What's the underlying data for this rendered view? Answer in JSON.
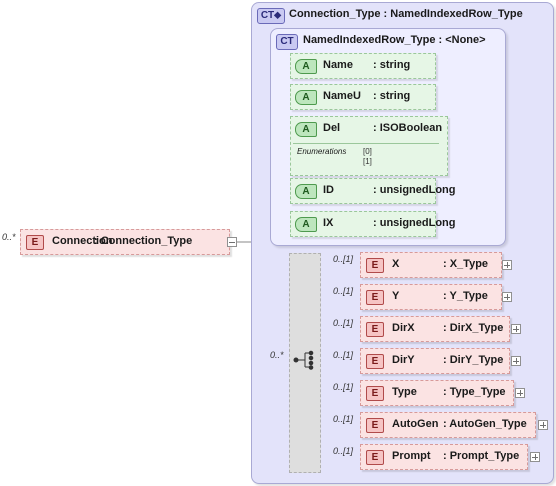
{
  "root_element": {
    "badge": "E",
    "name": "Connection",
    "type": ": Connection_Type",
    "cardinality": "0..*"
  },
  "outer_complex_type": {
    "badge": "CT",
    "title": "Connection_Type : NamedIndexedRow_Type"
  },
  "inner_complex_type": {
    "badge": "CT",
    "title": "NamedIndexedRow_Type : <None>"
  },
  "attributes": [
    {
      "badge": "A",
      "name": "Name",
      "type": ": string"
    },
    {
      "badge": "A",
      "name": "NameU",
      "type": ": string"
    },
    {
      "badge": "A",
      "name": "Del",
      "type": ": ISOBoolean",
      "enum_label": "Enumerations",
      "enum_values": [
        "[0]",
        "[1]"
      ]
    },
    {
      "badge": "A",
      "name": "ID",
      "type": ": unsignedLong"
    },
    {
      "badge": "A",
      "name": "IX",
      "type": ": unsignedLong"
    }
  ],
  "sequence_cardinality": "0..*",
  "child_elements": [
    {
      "badge": "E",
      "name": "X",
      "type": ": X_Type",
      "cardinality": "0..[1]"
    },
    {
      "badge": "E",
      "name": "Y",
      "type": ": Y_Type",
      "cardinality": "0..[1]"
    },
    {
      "badge": "E",
      "name": "DirX",
      "type": ": DirX_Type",
      "cardinality": "0..[1]"
    },
    {
      "badge": "E",
      "name": "DirY",
      "type": ": DirY_Type",
      "cardinality": "0..[1]"
    },
    {
      "badge": "E",
      "name": "Type",
      "type": ": Type_Type",
      "cardinality": "0..[1]"
    },
    {
      "badge": "E",
      "name": "AutoGen",
      "type": ": AutoGen_Type",
      "cardinality": "0..[1]"
    },
    {
      "badge": "E",
      "name": "Prompt",
      "type": ": Prompt_Type",
      "cardinality": "0..[1]"
    }
  ]
}
